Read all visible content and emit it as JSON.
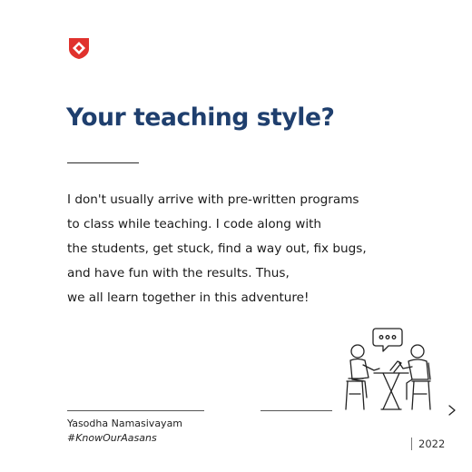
{
  "brand": {
    "logo_icon": "brand-shield-logo",
    "accent": "#e0322d"
  },
  "heading": {
    "text": "Your teaching style?",
    "color": "#1f3f6e"
  },
  "body": {
    "lines": [
      "I don't usually arrive with pre-written programs",
      "to class while teaching. I code along with",
      "the students, get stuck, find a way out, fix bugs,",
      "and have fun with the results. Thus,",
      "we all learn together in this adventure!"
    ]
  },
  "illustration": {
    "icon": "two-people-conversation-icon"
  },
  "footer": {
    "name": "Yasodha Namasivayam",
    "hashtag": "#KnowOurAasans",
    "year": "2022",
    "next_icon": "arrow-right-icon"
  }
}
